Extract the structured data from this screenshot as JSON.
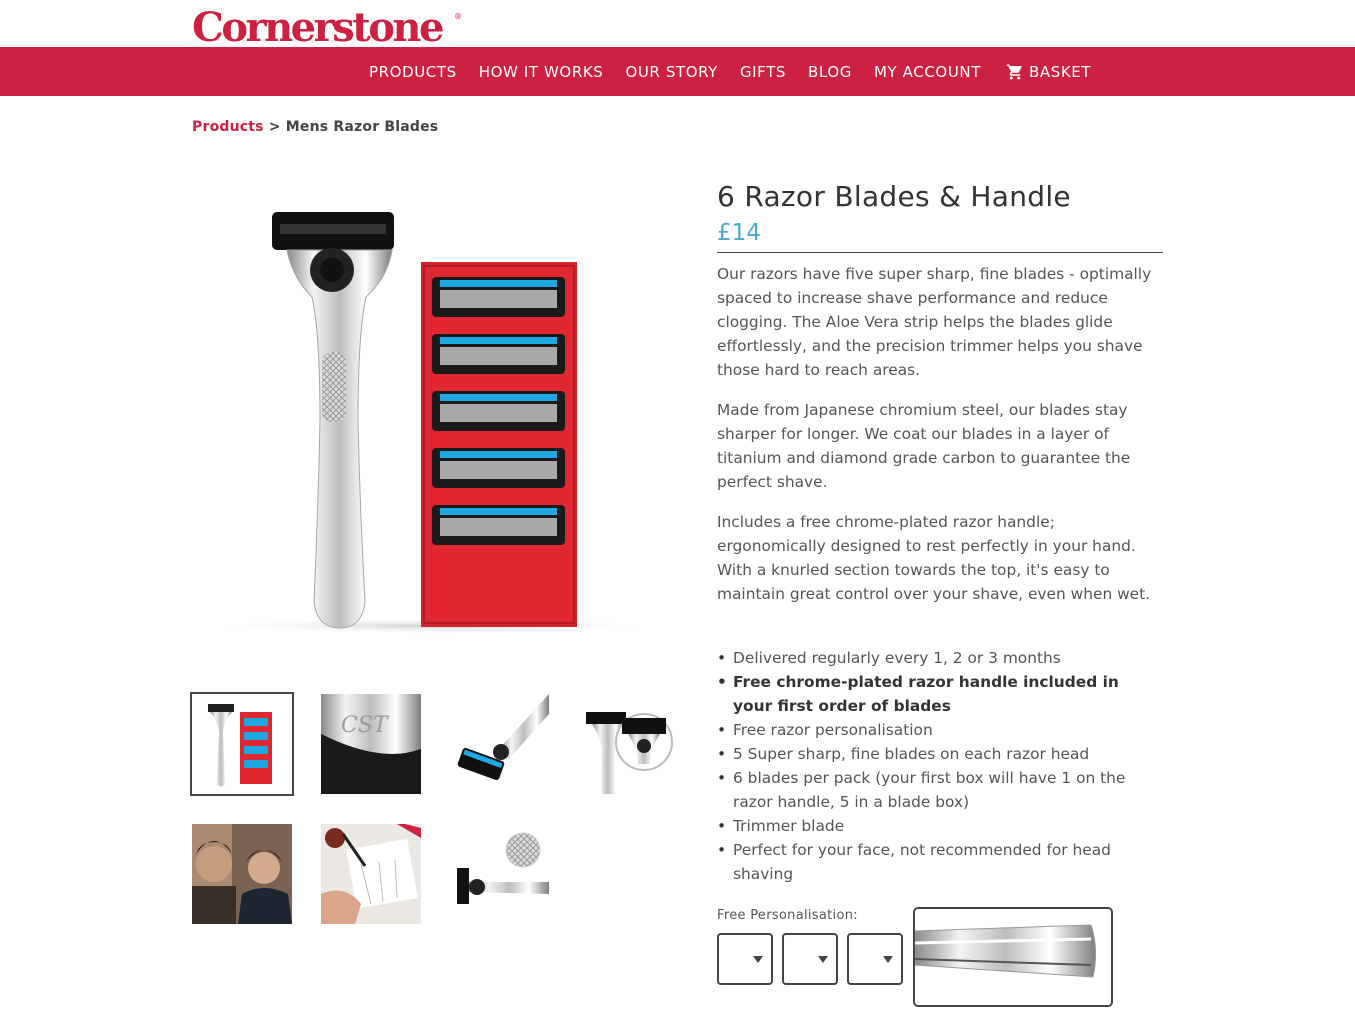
{
  "brand": {
    "logo": "Cornerstone",
    "reg": "®"
  },
  "nav": {
    "items": [
      "PRODUCTS",
      "HOW IT WORKS",
      "OUR STORY",
      "GIFTS",
      "BLOG",
      "MY ACCOUNT"
    ],
    "basket": "BASKET"
  },
  "breadcrumb": {
    "link": "Products",
    "sep": ">",
    "current": "Mens Razor Blades"
  },
  "product": {
    "title": "6 Razor Blades & Handle",
    "price": "£14",
    "desc1": "Our razors have five super sharp, fine blades - optimally spaced to increase shave performance and reduce clogging. The Aloe Vera strip helps the blades glide effortlessly, and the precision trimmer helps you shave those hard to reach areas.",
    "desc2": "Made from Japanese chromium steel, our blades stay sharper for longer. We coat our blades in a layer of titanium and diamond grade carbon to guarantee the perfect shave.",
    "desc3": "Includes a free chrome-plated razor handle; ergonomically designed to rest perfectly in your hand. With a knurled section towards the top, it's easy to maintain great control over your shave, even when wet.",
    "features": [
      "Delivered regularly every 1, 2 or 3 months",
      "Free chrome-plated razor handle included in your first order of blades",
      "Free razor personalisation",
      "5 Super sharp, fine blades on each razor head",
      "6 blades per pack (your first box will have 1 on the razor handle, 5 in a blade box)",
      "Trimmer blade",
      "Perfect for your face, not recommended for head shaving"
    ],
    "personalisation_label": "Free Personalisation:",
    "engraving_text": "CST"
  },
  "colors": {
    "brand_red": "#cc2140",
    "price_blue": "#4aaac8",
    "blade_blue": "#1ea7e1"
  }
}
